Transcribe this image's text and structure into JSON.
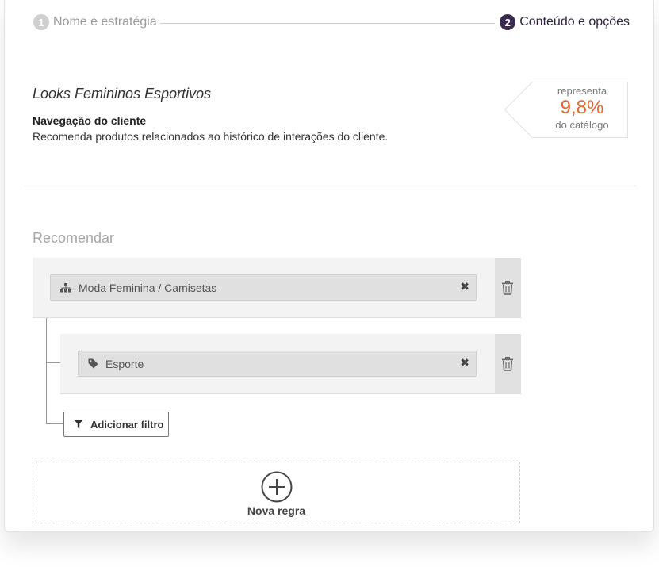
{
  "stepper": {
    "step1": {
      "number": "1",
      "label": "Nome e estratégia"
    },
    "step2": {
      "number": "2",
      "label": "Conteúdo e opções"
    }
  },
  "strategy": {
    "title": "Looks Femininos Esportivos",
    "subtitle": "Navegação do cliente",
    "description": "Recomenda produtos relacionados ao histórico de interações do cliente."
  },
  "catalog_badge": {
    "top": "representa",
    "value": "9,8%",
    "bottom": "do catálogo",
    "value_color": "#e8642c"
  },
  "recommend": {
    "section_title": "Recomendar",
    "rules": [
      {
        "icon": "sitemap-icon",
        "label": "Moda Feminina / Camisetas"
      },
      {
        "icon": "tag-icon",
        "label": "Esporte"
      }
    ],
    "add_filter_label": "Adicionar filtro",
    "new_rule_label": "Nova regra"
  },
  "colors": {
    "accent": "#3b2a4f",
    "highlight": "#e8642c"
  }
}
